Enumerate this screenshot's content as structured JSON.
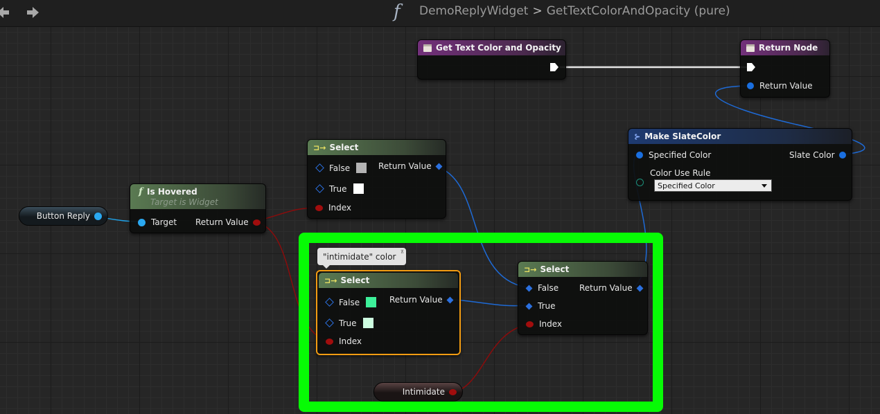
{
  "toolbar": {
    "back_icon": "back-arrow-icon",
    "forward_icon": "forward-arrow-icon",
    "function_icon": "function-f-icon"
  },
  "breadcrumb": {
    "parent": "DemoReplyWidget",
    "separator": ">",
    "current": "GetTextColorAndOpacity (pure)"
  },
  "nodes": {
    "entry": {
      "title": "Get Text Color and Opacity"
    },
    "return_node": {
      "title": "Return Node",
      "return_label": "Return Value"
    },
    "make_slate_color": {
      "title": "Make SlateColor",
      "specified_color": "Specified Color",
      "slate_color": "Slate Color",
      "color_use_rule": "Color Use Rule",
      "dropdown_value": "Specified Color"
    },
    "select_top": {
      "title": "Select",
      "false_label": "False",
      "true_label": "True",
      "index_label": "Index",
      "return_label": "Return Value",
      "false_color": "#b4b4b4",
      "true_color": "#ffffff"
    },
    "is_hovered": {
      "title": "Is Hovered",
      "subtitle": "Target is Widget",
      "target_label": "Target",
      "return_label": "Return Value"
    },
    "button_reply": {
      "label": "Button Reply"
    },
    "select_inner": {
      "title": "Select",
      "false_label": "False",
      "true_label": "True",
      "index_label": "Index",
      "return_label": "Return Value",
      "false_color": "#3df09a",
      "true_color": "#cdfde0"
    },
    "select_right": {
      "title": "Select",
      "false_label": "False",
      "true_label": "True",
      "index_label": "Index",
      "return_label": "Return Value"
    },
    "intimidate": {
      "label": "Intimidate"
    }
  },
  "comment": {
    "text": "\"intimidate\" color"
  },
  "colors": {
    "highlight_box": "#07fb05",
    "selected_outline": "#f39c12",
    "exec_wire": "#ffffff",
    "struct_wire": "#1e6ad6",
    "bool_wire": "#8a0c0c",
    "object_wire": "#1fa3ea"
  }
}
